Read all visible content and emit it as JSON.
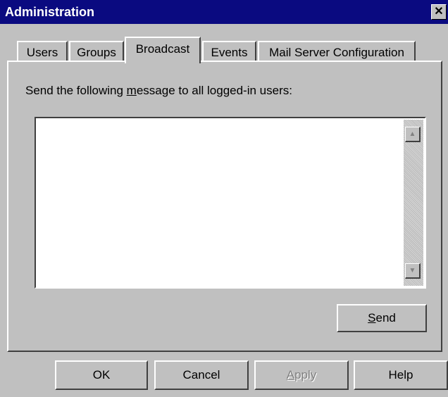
{
  "window": {
    "title": "Administration",
    "close_label": "✕"
  },
  "tabs": [
    {
      "label": "Users",
      "active": false
    },
    {
      "label": "Groups",
      "active": false
    },
    {
      "label": "Broadcast",
      "active": true
    },
    {
      "label": "Events",
      "active": false
    },
    {
      "label": "Mail Server Configuration",
      "active": false
    }
  ],
  "broadcast": {
    "prompt_before": "Send the following ",
    "prompt_mnemonic": "m",
    "prompt_after": "essage to all logged-in users:",
    "message_value": "",
    "send_mnemonic": "S",
    "send_rest": "end"
  },
  "footer": {
    "ok_label": "OK",
    "cancel_label": "Cancel",
    "apply_mnemonic": "A",
    "apply_rest": "pply",
    "help_label": "Help"
  },
  "icons": {
    "scroll_up": "scroll-up-arrow-icon",
    "scroll_down": "scroll-down-arrow-icon",
    "close": "close-icon"
  }
}
